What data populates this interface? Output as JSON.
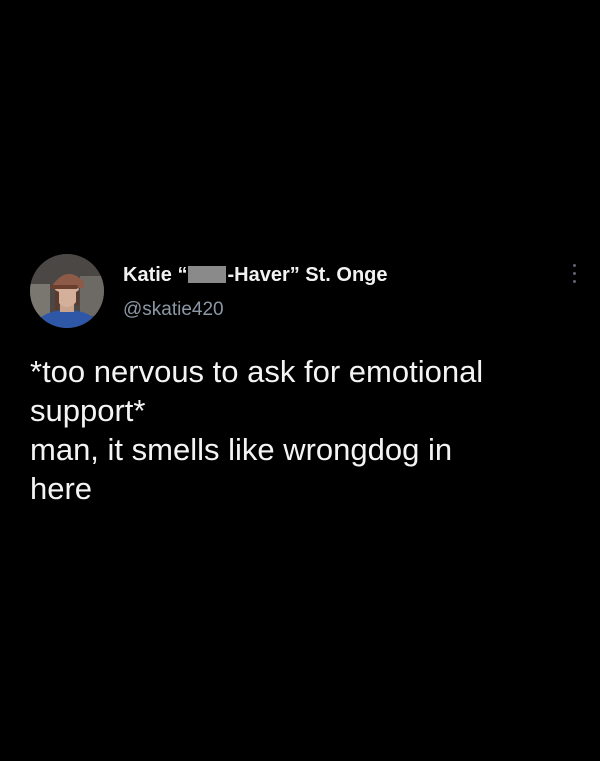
{
  "tweet": {
    "author": {
      "name_part1": "Katie “",
      "name_part2": "-Haver” St. Onge",
      "handle": "@skatie420",
      "avatar_icon": "profile-photo"
    },
    "more_icon": "vertical-ellipsis-icon",
    "text_lines": [
      "*too nervous to ask for emotional",
      "support*",
      "man, it smells like wrongdog in",
      "here"
    ]
  },
  "colors": {
    "background": "#000000",
    "name": "#f2f2f2",
    "handle": "#8b98a5",
    "body": "#f4f4f4",
    "redaction": "#8a8a8a"
  }
}
